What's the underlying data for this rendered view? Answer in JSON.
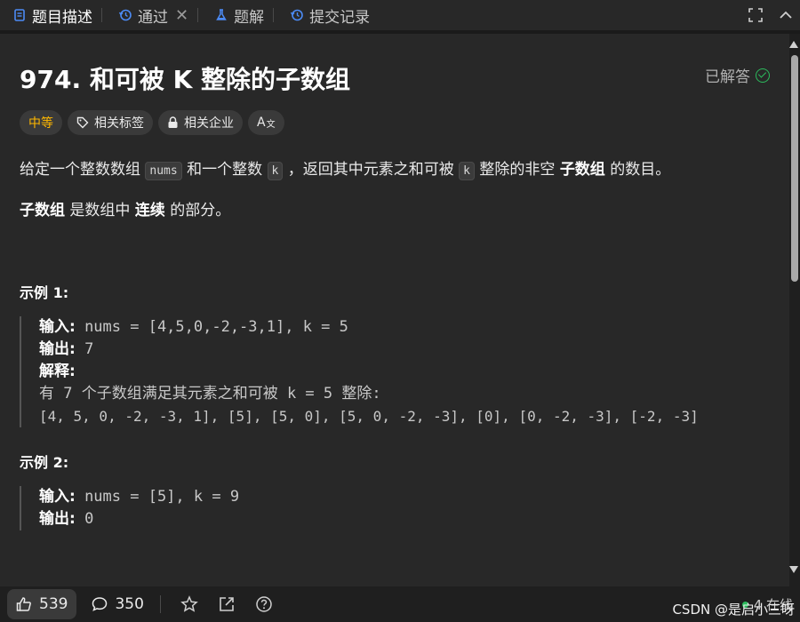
{
  "tabs": [
    {
      "label": "题目描述",
      "icon": "document-icon",
      "active": true
    },
    {
      "label": "通过",
      "icon": "history-icon",
      "closable": true
    },
    {
      "label": "题解",
      "icon": "flask-icon"
    },
    {
      "label": "提交记录",
      "icon": "history-icon"
    }
  ],
  "problem": {
    "title": "974. 和可被 K 整除的子数组",
    "status": "已解答",
    "tags": {
      "difficulty": "中等",
      "related_tags": "相关标签",
      "related_companies": "相关企业",
      "font_toggle": "A"
    },
    "desc": {
      "p1_a": "给定一个整数数组",
      "p1_code1": "nums",
      "p1_b": "和一个整数",
      "p1_code2": "k",
      "p1_c": "，返回其中元素之和可被",
      "p1_code3": "k",
      "p1_d": "整除的非空",
      "p1_bold": "子数组",
      "p1_e": "的数目。",
      "p2_bold1": "子数组",
      "p2_a": "是数组中",
      "p2_bold2": "连续",
      "p2_b": "的部分。"
    },
    "examples": [
      {
        "title": "示例 1:",
        "input_label": "输入:",
        "input": "nums = [4,5,0,-2,-3,1], k = 5",
        "output_label": "输出:",
        "output": "7",
        "explain_label": "解释:",
        "explain_line1": "有 7 个子数组满足其元素之和可被 k = 5 整除:",
        "explain_line2": "[4, 5, 0, -2, -3, 1], [5], [5, 0], [5, 0, -2, -3], [0], [0, -2, -3], [-2, -3]"
      },
      {
        "title": "示例 2:",
        "input_label": "输入:",
        "input": "nums = [5], k = 9",
        "output_label": "输出:",
        "output": "0"
      }
    ]
  },
  "bottombar": {
    "likes": "539",
    "comments": "350",
    "online": "4 在线",
    "watermark": "CSDN @是启小三呀"
  },
  "colors": {
    "accent_difficulty": "#ffb800",
    "solved_green": "#2cbb5d",
    "panel_bg": "#282828"
  }
}
